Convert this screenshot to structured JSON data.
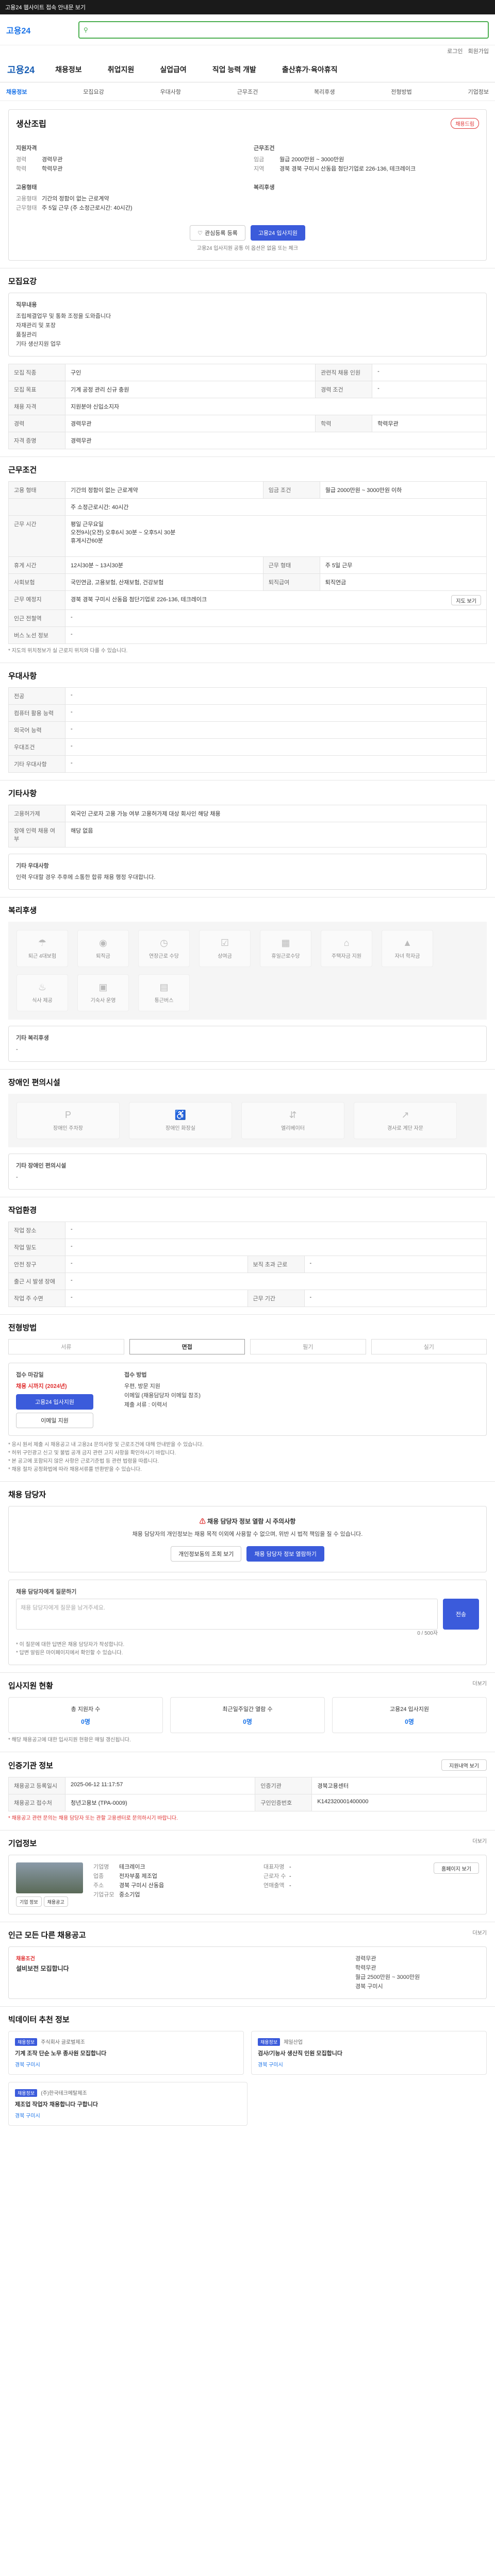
{
  "topbar": {
    "text": "고용24 웹사이트 접속 안내문 보기"
  },
  "header": {
    "logo": "고용24",
    "search_placeholder": "",
    "util": [
      "로그인",
      "회원가입"
    ]
  },
  "gnb": {
    "brand": "고용24",
    "items": [
      "채용정보",
      "취업지원",
      "실업급여",
      "직업 능력 개발",
      "출산휴가·육아휴직"
    ]
  },
  "subtabs": {
    "items": [
      "채용정보",
      "모집요강",
      "우대사항",
      "근무조건",
      "복리후생",
      "전형방법",
      "기업정보"
    ]
  },
  "summary": {
    "title": "생산조립",
    "badge": "채용드림",
    "left_head": "지원자격",
    "left_rows": [
      {
        "k": "경력",
        "v": "경력무관"
      },
      {
        "k": "학력",
        "v": "학력무관"
      }
    ],
    "right_head": "근무조건",
    "right_rows": [
      {
        "k": "임금",
        "v": "월급 2000만원 ~ 3000만원"
      },
      {
        "k": "지역",
        "v": "경북 경북 구미시 산동읍 첨단기업로 226-136, 테크레이크"
      }
    ],
    "left_head2": "고용형태",
    "left_rows2": [
      {
        "k": "고용형태",
        "v": "기간의 정함이 없는 근로계약"
      },
      {
        "k": "근무형태",
        "v": "주 5일 근무 (주 소정근로시간: 40시간)"
      }
    ],
    "right_head2": "복리후생",
    "btn_scrap": "관심등록 등록",
    "btn_apply": "고용24 입사지원",
    "note": "고용24 입사지원 공통 이 옵션은 없음 또는 체크 "
  },
  "recruit": {
    "title": "모집요강",
    "job_head": "직무내용",
    "job_lines": [
      "조립체결업무 및 통화 조정을 도와줍니다",
      "자재관리 및 포장",
      "품질관리",
      "기타 생산지원 업무"
    ],
    "rows": [
      {
        "k": "모집 직종",
        "v": "구인",
        "k2": "관련직 채용 인원",
        "v2": "-"
      },
      {
        "k": "모집 목표",
        "v": "기계 공정 관리 신규 충원",
        "k2": "경력 조건",
        "v2": "-"
      },
      {
        "k": "채용 자격",
        "v": "지원분야 신입소지자",
        "k2": "",
        "v2": ""
      },
      {
        "k": "경력",
        "v": "경력무관",
        "k2": "학력",
        "v2": "학력무관"
      },
      {
        "k": "자격 증명",
        "v": "경력무관",
        "k2": "",
        "v2": ""
      }
    ]
  },
  "conditions": {
    "title": "근무조건",
    "rows": [
      {
        "k": "고용 형태",
        "v": "기간의 정함이 없는 근로계약",
        "k2": "임금 조건",
        "v2": "월급 2000만원 ~ 3000만원 이하"
      },
      {
        "k": "",
        "v": "주 소정근로시간: 40시간",
        "k2": "",
        "v2": ""
      },
      {
        "k": "근무 시간",
        "v": "평일 근무요일\n오전9시(오전) 오후6시 30분 ~ 오후5시 30분\n휴게시간60분",
        "k2": "",
        "v2": ""
      },
      {
        "k": "휴게 시간",
        "v": "12시30분 ~ 13시30분",
        "k2": "근무 형태",
        "v2": "주 5일 근무"
      },
      {
        "k": "사회보험",
        "v": "국민연금, 고용보험, 산재보험, 건강보험",
        "k2": "퇴직급여",
        "v2": "퇴직연금"
      },
      {
        "k": "근무 예정지",
        "v": "경북 경북 구미시 산동읍 첨단기업로 226-136, 테크레이크",
        "k2": "",
        "v2": ""
      },
      {
        "k": "인근 전철역",
        "v": "-",
        "k2": "",
        "v2": ""
      },
      {
        "k": "버스 노선 정보",
        "v": "-",
        "k2": "",
        "v2": ""
      }
    ],
    "map_btn": "지도 보기",
    "note": "* 지도의 위치정보가 실 근로지 위치와 다를 수 있습니다."
  },
  "prefer": {
    "title": "우대사항",
    "rows": [
      {
        "k": "전공",
        "v": "-"
      },
      {
        "k": "컴퓨터 활용 능력",
        "v": "-"
      },
      {
        "k": "외국어 능력",
        "v": "-"
      },
      {
        "k": "우대조건",
        "v": "-"
      },
      {
        "k": "기타 우대사항",
        "v": "-"
      }
    ]
  },
  "etc": {
    "title": "기타사항",
    "rows": [
      {
        "k": "고용허가제",
        "v": "외국인 근로자 고용 가능 여부 고용허가제 대상 회사인 해당 채용"
      },
      {
        "k": "장애 인력 채용 여부",
        "v": "해당 없음"
      }
    ],
    "extra_head": "기타 우대사항",
    "extra": "인력 우대할 경우 추후에 소통한 합류 채용 행정 우대합니다."
  },
  "welfare": {
    "title": "복리후생",
    "items": [
      "퇴근 4대보험",
      "퇴직금",
      "연장근로 수당",
      "상여금",
      "휴일근로수당",
      "주택자금 지원",
      "자녀 학자금",
      "식사 제공",
      "기숙사 운영",
      "통근버스"
    ],
    "other_head": "기타 복리후생",
    "other_val": "-"
  },
  "disabled": {
    "title": "장애인 편의시설",
    "items": [
      "장애인 주차장",
      "장애인 화장실",
      "엘리베이터",
      "경사로 계단 자문"
    ],
    "other_head": "기타 장애인 편의시설",
    "other_val": "-"
  },
  "work_env": {
    "title": "작업환경",
    "rows": [
      {
        "k": "작업 장소",
        "v": "-",
        "k2": "",
        "v2": ""
      },
      {
        "k": "작업 밀도",
        "v": "-",
        "k2": "",
        "v2": ""
      },
      {
        "k": "안전 장구",
        "v": "-",
        "k2": "보직 초과 근로",
        "v2": "-"
      },
      {
        "k": "출근 시 발생 장애",
        "v": "-",
        "k2": "",
        "v2": ""
      },
      {
        "k": "작업 주 수면",
        "v": "-",
        "k2": "근무 기간",
        "v2": "-"
      }
    ]
  },
  "screening": {
    "title": "전형방법",
    "tabs": [
      "서류",
      "면접",
      "필기",
      "실기"
    ],
    "left_head": "접수 마감일",
    "deadline": "채용 시까지 (2024년)",
    "btn_apply": "고용24 입사지원",
    "btn_email": "이메일 지원",
    "right_head": "접수 방법",
    "right_rows": [
      "우편, 방문 지원",
      "이메일 (채용담당자 이메일 참조)",
      "제출 서류 : 이력서"
    ],
    "notes": [
      "* 응시 원서 제출 시 채용공고 내 고용24 문의사항 및 근로조건에 대해 안내받을 수 있습니다.",
      "* 허위 구인광고 신고 및 불법 공개 금지 관련 고지 사항을 확인하시기 바랍니다.",
      "* 본 공고에 포함되지 않은 사항은 근로기준법 등 관련 법령을 따릅니다.",
      "* 채용 절차 공정화법에 따라 채용서류를 반환받을 수 있습니다."
    ]
  },
  "contact": {
    "title": "채용 담당자",
    "alert": "채용 담당자 정보 열람 시 주의사항",
    "alert_body": "채용 담당자의 개인정보는 채용 목적 이외에 사용할 수 없으며, 위반 시 법적 책임을 질 수 있습니다.",
    "btn1": "개인정보동의 조회 보기",
    "btn2": "채용 담당자 정보 열람하기",
    "qa_head": "채용 담당자에게 질문하기",
    "qa_placeholder": "채용 담당자에게 질문을 남겨주세요.",
    "qa_counter": "0 / 500자",
    "qa_btn": "전송",
    "notes": [
      "* 이 질문에 대한 답변은 채용 담당자가 작성합니다.",
      "* 답변 알림은 마이페이지에서 확인할 수 있습니다."
    ]
  },
  "stats": {
    "title": "입사지원 현황",
    "more": "더보기",
    "boxes": [
      {
        "label": "총 지원자 수",
        "num": "0명"
      },
      {
        "label": "최근일주일간 열람 수",
        "num": "0명"
      },
      {
        "label": "고용24 입사지원",
        "num": "0명"
      }
    ],
    "note": "* 해당 채용공고에 대한 입사지원 현황은 매일 갱신됩니다."
  },
  "manage": {
    "title": "인증기관 정보",
    "btn": "지원내역 보기",
    "rows": [
      {
        "k": "채용공고 등록일시",
        "v": "2025-06-12 11:17:57",
        "k2": "인증기관",
        "v2": "경북고용센터"
      },
      {
        "k": "채용공고 접수처",
        "v": "청년고용보 (TPA-0009)",
        "k2": "구인인증번호",
        "v2": "K142320001400000"
      }
    ],
    "note": "* 채용공고 관련 문의는 채용 담당자 또는 관할 고용센터로 문의하시기 바랍니다."
  },
  "company": {
    "title": "기업정보",
    "more": "더보기",
    "rows": [
      {
        "k": "기업명",
        "v": "테크레이크"
      },
      {
        "k": "업종",
        "v": "전자부품 제조업"
      },
      {
        "k": "주소",
        "v": "경북 구미시 산동읍"
      },
      {
        "k": "기업규모",
        "v": "중소기업"
      }
    ],
    "rows2": [
      {
        "k": "대표자명",
        "v": "-"
      },
      {
        "k": "근로자 수",
        "v": "-"
      },
      {
        "k": "연매출액",
        "v": "-"
      }
    ],
    "btn_home": "홈페이지 보기",
    "btn_a": "기업 정보",
    "btn_b": "채용공고"
  },
  "related": {
    "title": "인근 모든 다른 채용공고",
    "more": "더보기",
    "left_badge": "채용조건",
    "left_title": "설비보전 모집합니다",
    "right_rows": [
      "경력무관",
      "학력무관",
      "월급 2500만원 ~ 3000만원",
      "경북 구미시"
    ]
  },
  "recommend": {
    "title": "빅데이터 추천 정보",
    "cards": [
      {
        "badge": "채용정보",
        "company": "주식회사 글로벌제조",
        "job": "기계 조작 단순 노무 종사원 모집합니다",
        "info": "경북 구미시"
      },
      {
        "badge": "채용정보",
        "company": "제일산업",
        "job": "검사/기능사 생산직 인원 모집합니다",
        "info": "경북 구미시"
      },
      {
        "badge": "채용정보",
        "company": "(주)한국테크메탈제조",
        "job": "제조업 작업자 채용합니다 구합니다",
        "info": "경북 구미시"
      }
    ]
  }
}
